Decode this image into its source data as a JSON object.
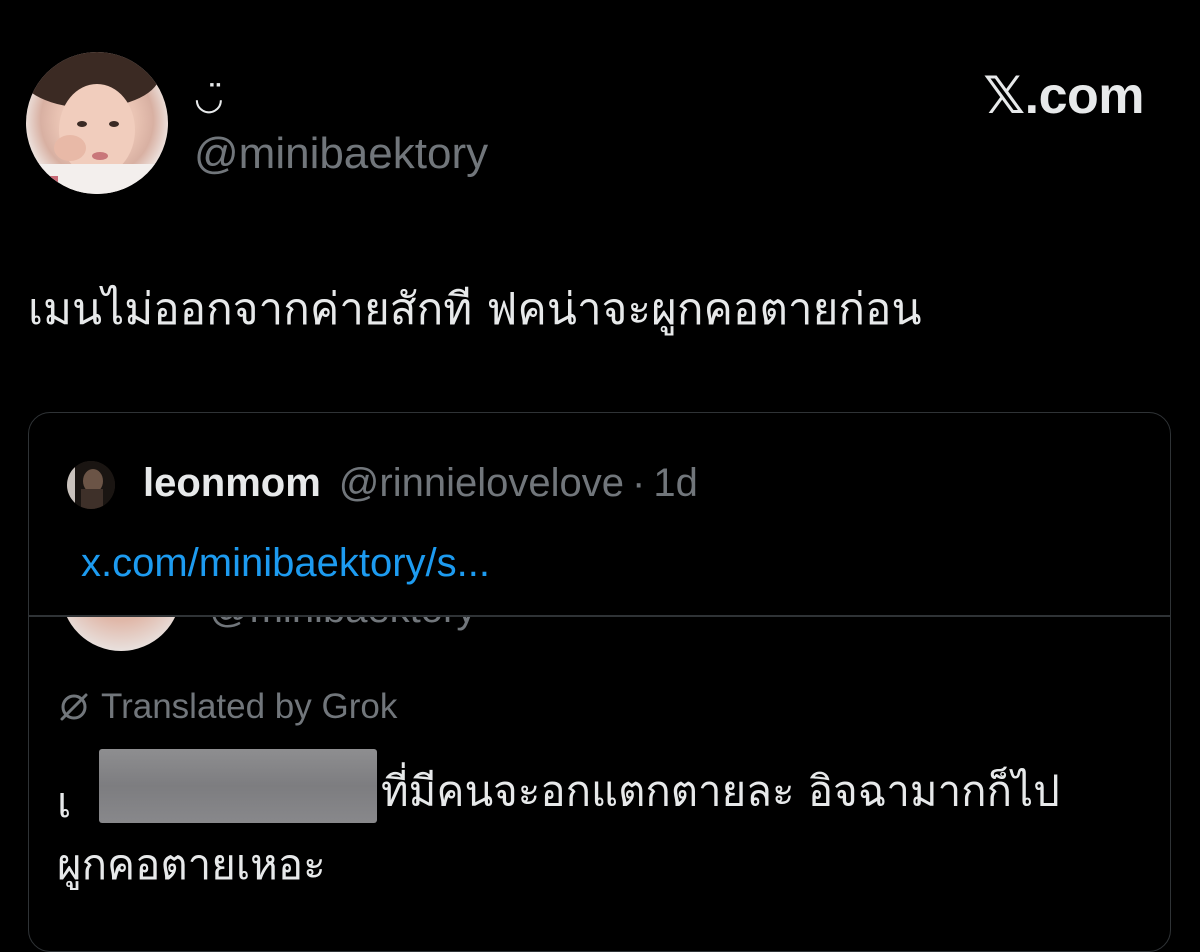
{
  "post": {
    "display_name": "◡̈",
    "handle": "@minibaektory",
    "brand": "𝕏.com",
    "text": "เมนไม่ออกจากค่ายสักที ฟคน่าจะผูกคอตายก่อน"
  },
  "quote": {
    "name": "leonmom",
    "handle": "@rinnielovelove",
    "separator": "·",
    "time": "1d",
    "link": "x.com/minibaektory/s...",
    "cut_handle": "@minibaektory",
    "translated_label": "Translated by Grok",
    "translated_line1_lead": "เ",
    "translated_line1_rest": "ที่มีคนจะอกแตกตายละ อิจฉามากก็ไป",
    "translated_line2": "ผูกคอตายเหอะ"
  },
  "colors": {
    "background": "#000000",
    "text_primary": "#e7e9ea",
    "text_secondary": "#71767b",
    "link": "#1d9bf0",
    "border": "#2f3336",
    "redaction": "#818184"
  }
}
